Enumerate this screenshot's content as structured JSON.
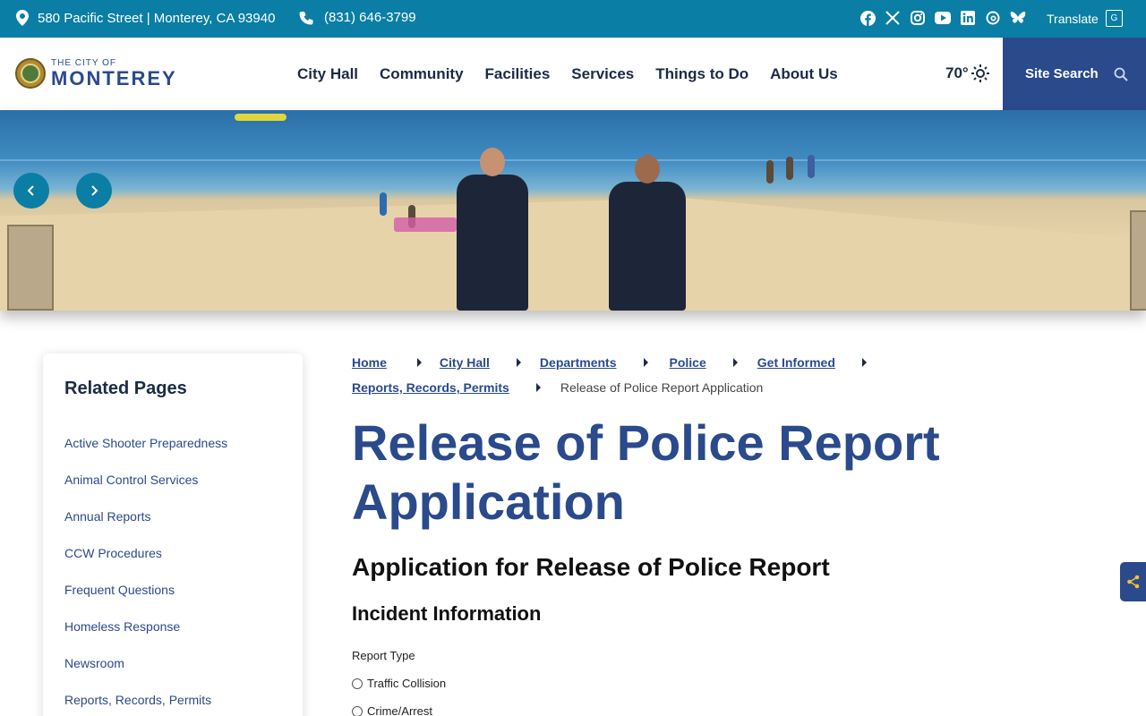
{
  "topbar": {
    "address": "580 Pacific Street | Monterey, CA 93940",
    "phone": "(831) 646-3799",
    "social_icons": [
      "facebook-icon",
      "x-icon",
      "instagram-icon",
      "youtube-icon",
      "linkedin-icon",
      "threads-icon",
      "bluesky-icon"
    ],
    "translate_label": "Translate"
  },
  "header": {
    "logo_small": "THE CITY OF",
    "logo_big": "MONTEREY",
    "nav": [
      "City Hall",
      "Community",
      "Facilities",
      "Services",
      "Things to Do",
      "About Us"
    ],
    "weather": "70°",
    "search_label": "Site Search"
  },
  "sidebar": {
    "title": "Related Pages",
    "items": [
      "Active Shooter Preparedness",
      "Animal Control Services",
      "Annual Reports",
      "CCW Procedures",
      "Frequent Questions",
      "Homeless Response",
      "Newsroom",
      "Reports, Records, Permits"
    ]
  },
  "breadcrumb": {
    "links": [
      "Home",
      "City Hall",
      "Departments",
      "Police",
      "Get Informed",
      "Reports, Records, Permits"
    ],
    "current": "Release of Police Report Application"
  },
  "main": {
    "title": "Release of Police Report Application",
    "form_heading": "Application for Release of Police Report",
    "section_heading": "Incident Information",
    "report_type_label": "Report Type",
    "report_options": [
      "Traffic Collision",
      "Crime/Arrest"
    ]
  },
  "colors": {
    "topbar": "#0a7ea4",
    "brand_blue": "#2a4a8c",
    "nav_text": "#1c2a46"
  }
}
